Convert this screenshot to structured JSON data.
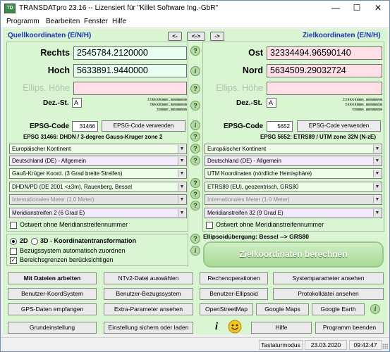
{
  "window": {
    "title": "TRANSDATpro 23.16 -- Lizensiert für \"Killet Software Ing.-GbR\"",
    "app_icon": "TD",
    "minimize_glyph": "—",
    "maximize_glyph": "☐",
    "close_glyph": "✕"
  },
  "menu": [
    "Programm",
    "Bearbeiten",
    "Fenster",
    "Hilfe"
  ],
  "nav": {
    "left": "<-",
    "both": "<->",
    "right": "->"
  },
  "source": {
    "header": "Quellkoordinaten (E/N/H)",
    "x_label": "Rechts",
    "x_value": "2545784.2120000",
    "y_label": "Hoch",
    "y_value": "5633891.9440000",
    "h_label": "Ellips. Höhe",
    "h_value": "",
    "dez_label": "Dez.-St.",
    "dez_value": "A",
    "format_lines": "±±kkkkmmm.mmmmmmm\n±kkkkmmm.mmmmmmm\n±mmmm.mmmmmmm",
    "epsg_label": "EPSG-Code",
    "epsg_value": "31466",
    "epsg_button": "EPSG-Code verwenden",
    "epsg_title": "EPSG 31466: DHDN / 3-degree Gauss-Kruger zone 2",
    "dropdowns": [
      {
        "value": "Europäischer Kontinent",
        "style": "green"
      },
      {
        "value": "Deutschland (DE) - Allgemein",
        "style": "violet"
      },
      {
        "value": "Gauß-Krüger Koord. (3 Grad breite Streifen)",
        "style": "green"
      },
      {
        "value": "DHDN/PD (DE 2001 <±3m), Rauenberg, Bessel",
        "style": "green"
      },
      {
        "value": "Internationales Meter (1.0 Meter)",
        "style": "dis"
      },
      {
        "value": "Meridianstreifen 2 (6 Grad E)",
        "style": "violet"
      }
    ],
    "ostwert_label": "Ostwert ohne Meridianstreifennummer"
  },
  "target": {
    "header": "Zielkoordinaten (E/N/H)",
    "x_label": "Ost",
    "x_value": "32334494.96590140",
    "y_label": "Nord",
    "y_value": "5634509.29032724",
    "h_label": "Ellips. Höhe",
    "h_value": "",
    "dez_label": "Dez.-St.",
    "dez_value": "A",
    "format_lines": "±±kkkkmmm.mmmmmmm\n±kkkkmmm.mmmmmmm\n±mmmm.mmmmmmm",
    "epsg_label": "EPSG-Code",
    "epsg_value": "5652",
    "epsg_button": "EPSG-Code verwenden",
    "epsg_title": "EPSG 5652: ETRS89 / UTM zone 32N (N-zE)",
    "dropdowns": [
      {
        "value": "Europäischer Kontinent",
        "style": "green"
      },
      {
        "value": "Deutschland (DE) - Allgemein",
        "style": "violet"
      },
      {
        "value": "UTM Koordinaten (nördliche Hemisphäre)",
        "style": "green"
      },
      {
        "value": "ETRS89 (EU), geozentrisch, GRS80",
        "style": "green"
      },
      {
        "value": "Internationales Meter (1.0 Meter)",
        "style": "dis"
      },
      {
        "value": "Meridianstreifen 32 (9 Grad E)",
        "style": "violet"
      }
    ],
    "ostwert_label": "Ostwert ohne Meridianstreifennummer"
  },
  "options": {
    "radio_2d": "2D",
    "radio_3d": "3D - Koordinatentransformation",
    "bezug_label": "Bezugssystem automatisch zuordnen",
    "bereich_label": "Bereichsgrenzen berücksichtigen",
    "bereich_checked": "✓"
  },
  "ellipsoid_text": "Ellipsoidübergang: Bessel --> GRS80",
  "calc_button": "Zielkoordinaten berechnen",
  "help_glyph": "?",
  "info_glyph": "i",
  "buttons_row1": [
    "Mit Dateien arbeiten",
    "NTv2-Datei auswählen",
    "Rechenoperationen",
    "Systemparameter ansehen"
  ],
  "buttons_row2": [
    "Benutzer-KoordSystem",
    "Benutzer-Bezugssystem",
    "Benutzer-Ellipsoid",
    "Protokolldatei ansehen"
  ],
  "buttons_row3": [
    "GPS-Daten empfangen",
    "Extra-Parameter ansehen",
    "OpenStreetMap",
    "Google Maps",
    "Google Earth"
  ],
  "buttons_row4": [
    "Grundeinstellung",
    "Einstellung sichern oder laden",
    "Hilfe",
    "Programm beenden"
  ],
  "status": {
    "mode": "Tastaturmodus",
    "date": "23.03.2020",
    "time": "09:42:47"
  },
  "colors": {
    "header_blue": "#1b32b8",
    "panel_green": "#d9f5d2",
    "source_input": "#e9fff0",
    "target_input": "#ffe0e6"
  }
}
